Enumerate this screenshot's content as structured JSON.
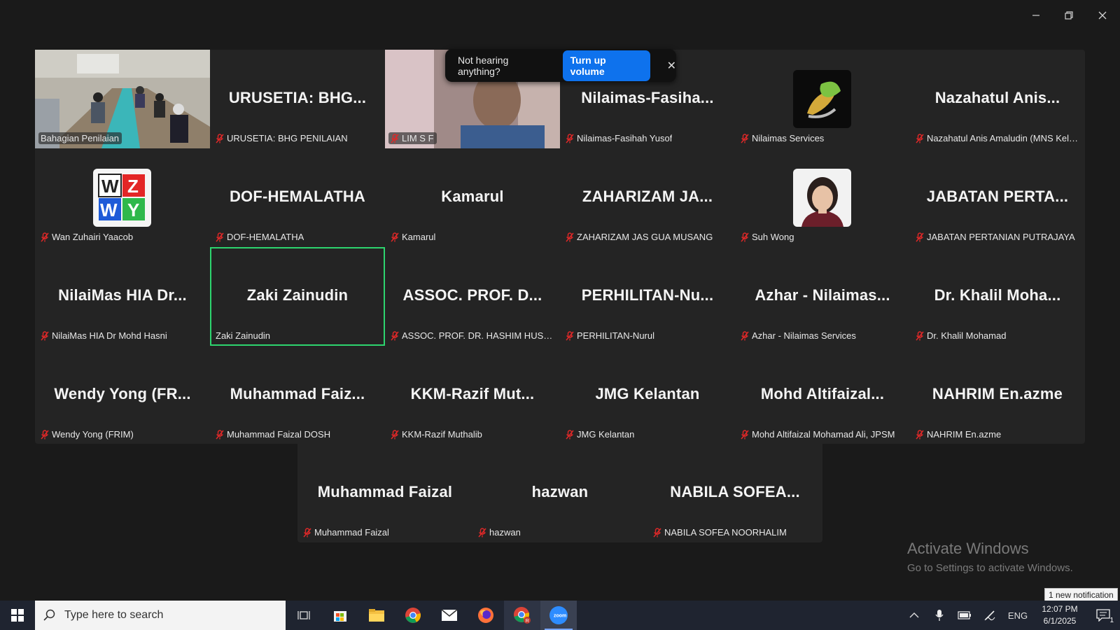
{
  "toast": {
    "message": "Not hearing anything?",
    "button": "Turn up volume"
  },
  "tiles_top": [
    {
      "big": "",
      "label": "Bahagian Penilaian",
      "muted": false,
      "kind": "photo-room"
    },
    {
      "big": "URUSETIA: BHG...",
      "label": "URUSETIA: BHG PENILAIAN",
      "muted": true
    },
    {
      "big": "",
      "label": "LIM S F",
      "muted": true,
      "kind": "photo-person"
    },
    {
      "big": "Nilaimas-Fasiha...",
      "label": "Nilaimas-Fasihah Yusof",
      "muted": true
    },
    {
      "big": "",
      "label": "Nilaimas Services",
      "muted": true,
      "kind": "avatar-leaf"
    },
    {
      "big": "Nazahatul Anis...",
      "label": "Nazahatul Anis Amaludin (MNS Kela...",
      "muted": true
    },
    {
      "big": "",
      "label": "Wan Zuhairi Yaacob",
      "muted": true,
      "kind": "avatar-wzwy"
    },
    {
      "big": "DOF-HEMALATHA",
      "label": "DOF-HEMALATHA",
      "muted": true
    },
    {
      "big": "Kamarul",
      "label": "Kamarul",
      "muted": true
    },
    {
      "big": "ZAHARIZAM JA...",
      "label": "ZAHARIZAM JAS GUA MUSANG",
      "muted": true
    },
    {
      "big": "",
      "label": "Suh Wong",
      "muted": true,
      "kind": "avatar-woman"
    },
    {
      "big": "JABATAN PERTA...",
      "label": "JABATAN PERTANIAN PUTRAJAYA",
      "muted": true
    },
    {
      "big": "NilaiMas HIA Dr...",
      "label": "NilaiMas HIA Dr Mohd Hasni",
      "muted": true
    },
    {
      "big": "Zaki Zainudin",
      "label": "Zaki Zainudin",
      "muted": false,
      "active": true
    },
    {
      "big": "ASSOC. PROF. D...",
      "label": "ASSOC. PROF. DR. HASHIM HUSSIN (...",
      "muted": true
    },
    {
      "big": "PERHILITAN-Nu...",
      "label": "PERHILITAN-Nurul",
      "muted": true
    },
    {
      "big": "Azhar - Nilaimas...",
      "label": "Azhar - Nilaimas Services",
      "muted": true
    },
    {
      "big": "Dr. Khalil Moha...",
      "label": "Dr. Khalil Mohamad",
      "muted": true
    },
    {
      "big": "Wendy Yong (FR...",
      "label": "Wendy Yong (FRIM)",
      "muted": true
    },
    {
      "big": "Muhammad Faiz...",
      "label": "Muhammad Faizal DOSH",
      "muted": true
    },
    {
      "big": "KKM-Razif Mut...",
      "label": "KKM-Razif Muthalib",
      "muted": true
    },
    {
      "big": "JMG Kelantan",
      "label": "JMG Kelantan",
      "muted": true
    },
    {
      "big": "Mohd Altifaizal...",
      "label": "Mohd Altifaizal Mohamad Ali, JPSM",
      "muted": true
    },
    {
      "big": "NAHRIM En.azme",
      "label": "NAHRIM En.azme",
      "muted": true
    }
  ],
  "tiles_bottom": [
    {
      "big": "Muhammad Faizal",
      "label": "Muhammad Faizal",
      "muted": true
    },
    {
      "big": "hazwan",
      "label": "hazwan",
      "muted": true
    },
    {
      "big": "NABILA SOFEA...",
      "label": "NABILA SOFEA NOORHALIM",
      "muted": true
    }
  ],
  "watermark": {
    "line1": "Activate Windows",
    "line2": "Go to Settings to activate Windows."
  },
  "notification_popup": "1 new notification",
  "taskbar": {
    "search_placeholder": "Type here to search",
    "apps": [
      "task-view-icon",
      "store-icon",
      "file-explorer-icon",
      "chrome-icon",
      "mail-icon",
      "firefox-icon",
      "chrome-profile-icon",
      "zoom-icon"
    ],
    "language": "ENG",
    "time": "12:07 PM",
    "date": "6/1/2025",
    "notification_count": "1"
  },
  "colors": {
    "active_speaker": "#2dd46e",
    "accent": "#0e72ed",
    "muted_mic": "#e02828"
  }
}
